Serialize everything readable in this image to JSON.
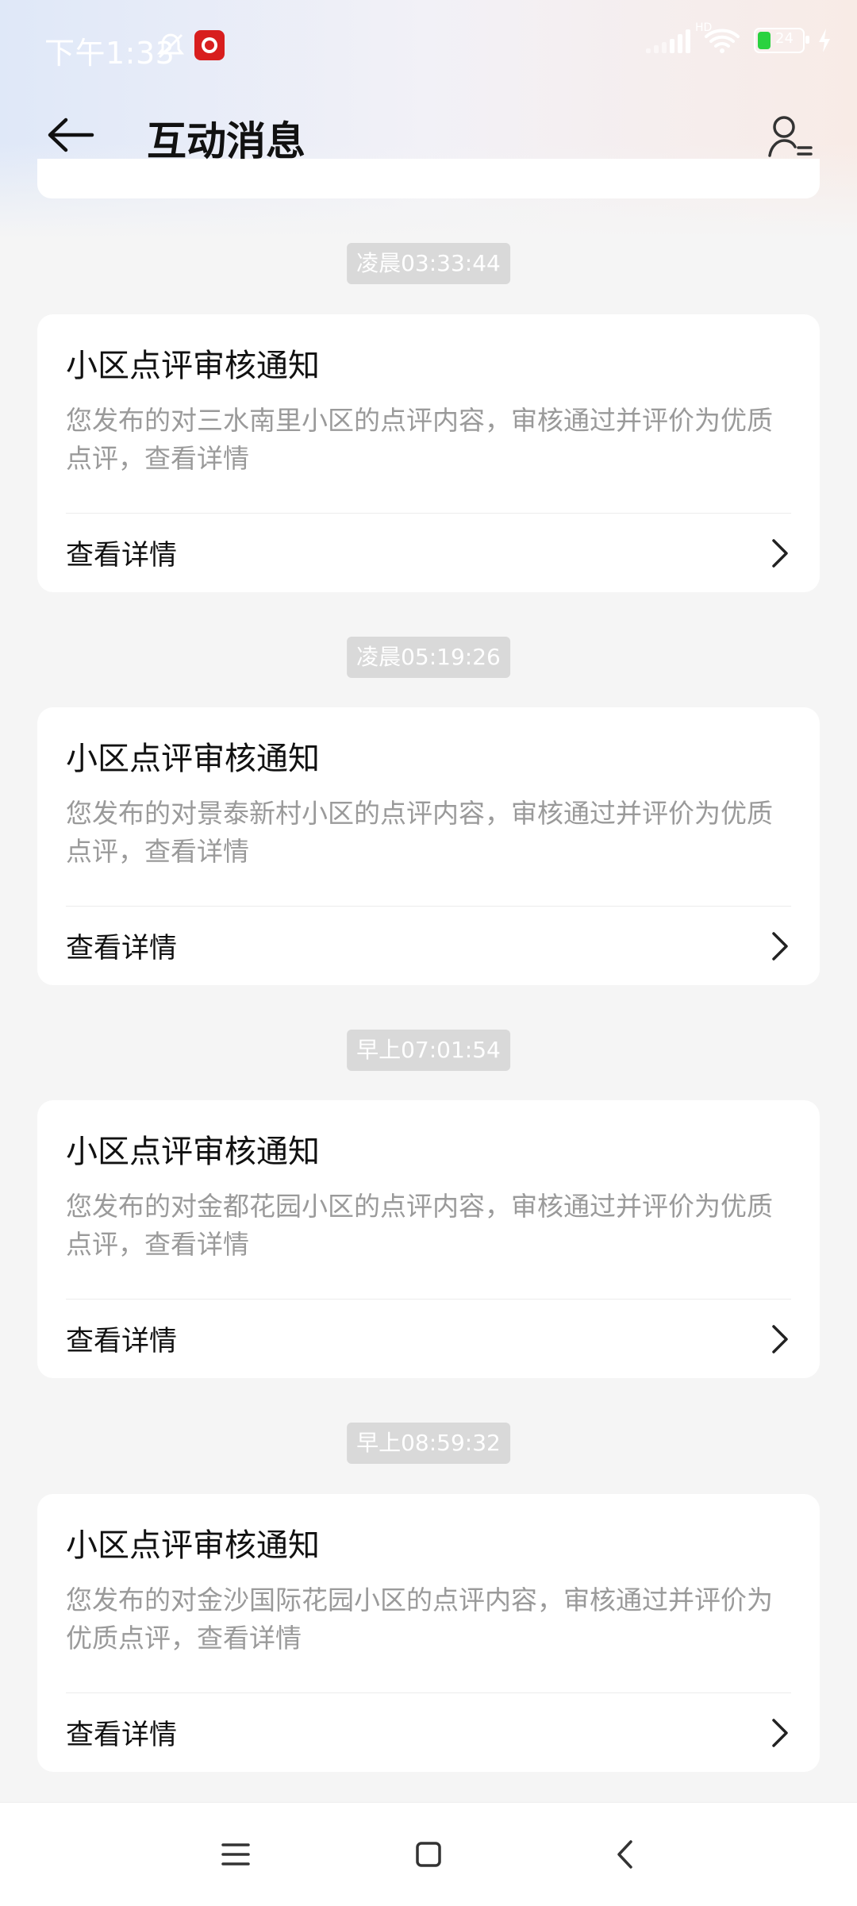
{
  "status_bar": {
    "time": "下午1:33",
    "network_label": "HD",
    "battery_percent": "24"
  },
  "header": {
    "title": "互动消息"
  },
  "messages": [
    {
      "timestamp": "凌晨03:33:44",
      "title": "小区点评审核通知",
      "body": "您发布的对三水南里小区的点评内容，审核通过并评价为优质点评，查看详情",
      "action_label": "查看详情"
    },
    {
      "timestamp": "凌晨05:19:26",
      "title": "小区点评审核通知",
      "body": "您发布的对景泰新村小区的点评内容，审核通过并评价为优质点评，查看详情",
      "action_label": "查看详情"
    },
    {
      "timestamp": "早上07:01:54",
      "title": "小区点评审核通知",
      "body": "您发布的对金都花园小区的点评内容，审核通过并评价为优质点评，查看详情",
      "action_label": "查看详情"
    },
    {
      "timestamp": "早上08:59:32",
      "title": "小区点评审核通知",
      "body": "您发布的对金沙国际花园小区的点评内容，审核通过并评价为优质点评，查看详情",
      "action_label": "查看详情"
    }
  ],
  "icons": {
    "back": "arrow-left-icon",
    "profile": "user-list-icon",
    "chevron": "chevron-right-icon",
    "nav_menu": "menu-icon",
    "nav_home": "home-square-icon",
    "nav_back": "back-triangle-icon"
  }
}
